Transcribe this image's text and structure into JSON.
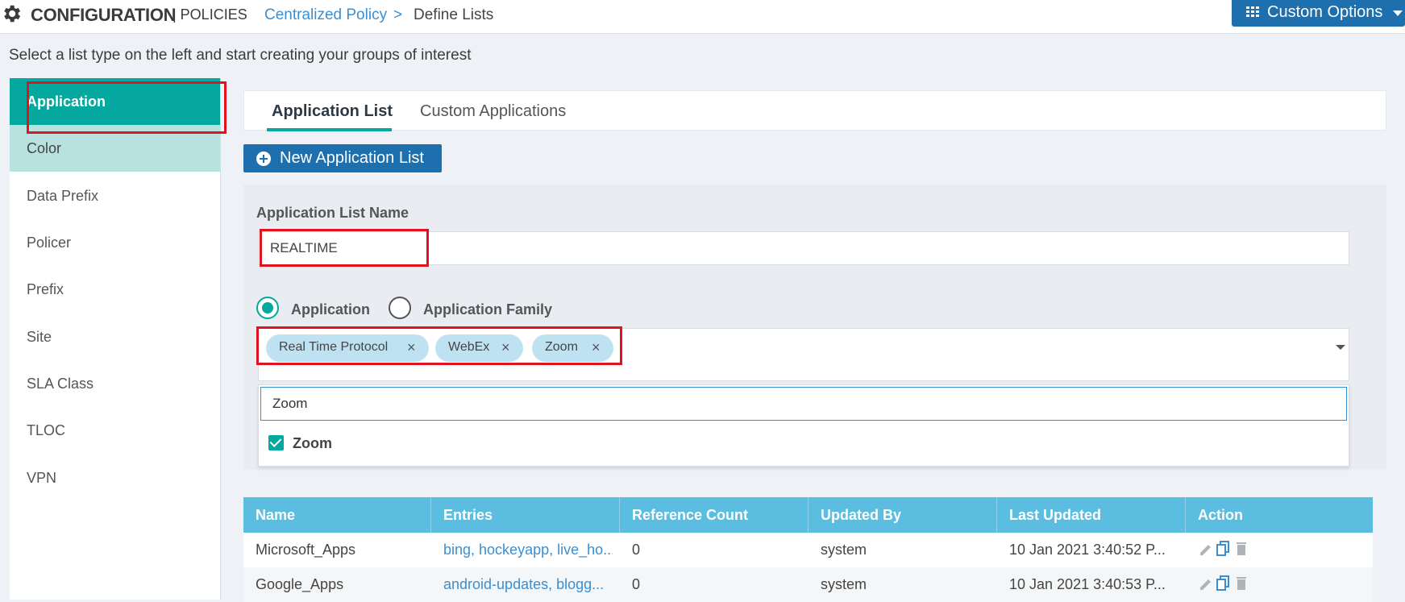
{
  "header": {
    "brand": "CONFIGURATION",
    "section": "| POLICIES",
    "breadcrumb_link": "Centralized Policy",
    "breadcrumb_arrow": ">",
    "breadcrumb_current": "Define Lists",
    "custom_options": "Custom Options",
    "icons": {
      "settings": "gear-icon",
      "options": "grid-icon",
      "dropdown": "caret-down-icon"
    }
  },
  "instruction": "Select a list type on the left and start creating your groups of interest",
  "sidebar": {
    "items": [
      {
        "label": "Application",
        "state": "active"
      },
      {
        "label": "Color",
        "state": "hover"
      },
      {
        "label": "Data Prefix",
        "state": "normal"
      },
      {
        "label": "Policer",
        "state": "normal"
      },
      {
        "label": "Prefix",
        "state": "normal"
      },
      {
        "label": "Site",
        "state": "normal"
      },
      {
        "label": "SLA Class",
        "state": "normal"
      },
      {
        "label": "TLOC",
        "state": "normal"
      },
      {
        "label": "VPN",
        "state": "normal"
      }
    ]
  },
  "tabs": [
    {
      "label": "Application List",
      "active": true
    },
    {
      "label": "Custom Applications",
      "active": false
    }
  ],
  "new_button": "New Application List",
  "form": {
    "name_label": "Application List Name",
    "name_value": "REALTIME",
    "radio_application": "Application",
    "radio_family": "Application Family",
    "selected_radio": "Application",
    "chips": [
      "Real Time Protocol",
      "WebEx",
      "Zoom"
    ],
    "chip_remove": "×",
    "search_value": "Zoom",
    "option": {
      "label": "Zoom",
      "checked": true
    }
  },
  "table": {
    "columns": [
      "Name",
      "Entries",
      "Reference Count",
      "Updated By",
      "Last Updated",
      "Action"
    ],
    "rows": [
      {
        "name": "Microsoft_Apps",
        "entries": "bing, hockeyapp, live_ho...",
        "ref": "0",
        "by": "system",
        "updated": "10 Jan 2021 3:40:52 P..."
      },
      {
        "name": "Google_Apps",
        "entries": "android-updates, blogg...",
        "ref": "0",
        "by": "system",
        "updated": "10 Jan 2021 3:40:53 P..."
      }
    ],
    "action_icons": [
      "edit-icon",
      "copy-icon",
      "delete-icon"
    ]
  },
  "colors": {
    "accent_teal": "#04a89e",
    "primary_blue": "#1e6fae",
    "table_header": "#5bbde0",
    "highlight_red": "#e0141e",
    "link_blue": "#3b8fd1"
  }
}
